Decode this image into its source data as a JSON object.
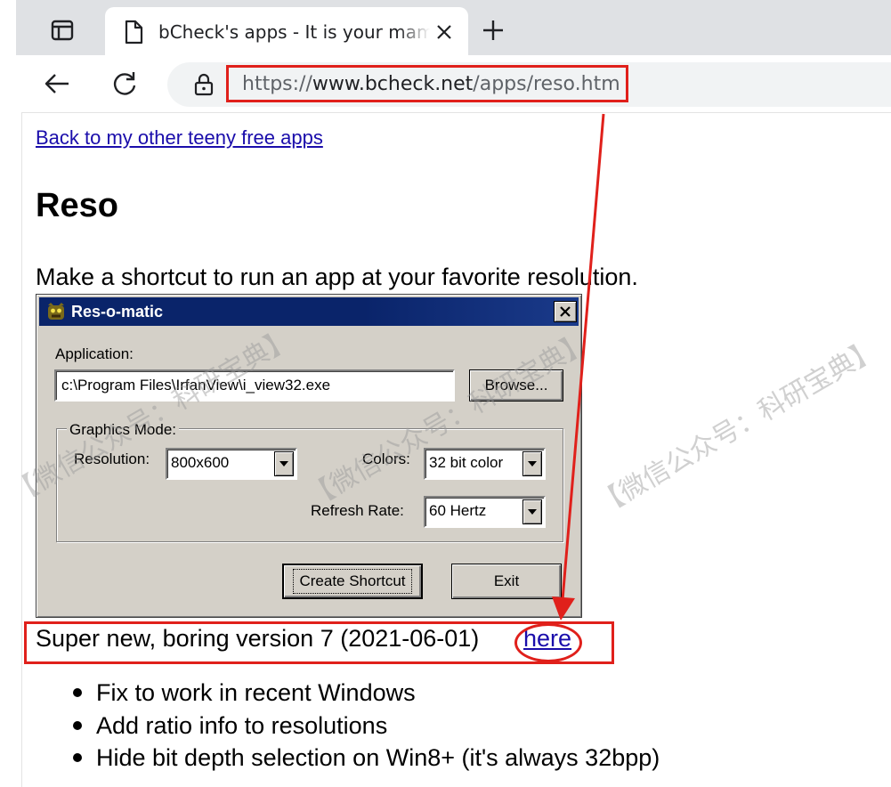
{
  "browser": {
    "tab_title": "bCheck's apps - It is your mama's",
    "url_prefix": "https://",
    "url_host": "www.bcheck.net",
    "url_path": "/apps/reso.htm"
  },
  "page": {
    "back_link": "Back to my other teeny free apps",
    "title": "Reso",
    "tagline": "Make a shortcut to run an app at your favorite resolution."
  },
  "dialog": {
    "title": "Res-o-matic",
    "application_label": "Application:",
    "application_value": "c:\\Program Files\\IrfanView\\i_view32.exe",
    "browse_button": "Browse...",
    "graphics_mode_label": "Graphics Mode:",
    "resolution_label": "Resolution:",
    "resolution_value": "800x600",
    "colors_label": "Colors:",
    "colors_value": "32 bit color",
    "refresh_label": "Refresh Rate:",
    "refresh_value": "60 Hertz",
    "create_button": "Create Shortcut",
    "exit_button": "Exit"
  },
  "version": {
    "text": "Super new, boring version 7 (2021-06-01)",
    "link": "here"
  },
  "notes": [
    "Fix to work in recent Windows",
    "Add ratio info to resolutions",
    "Hide bit depth selection on Win8+ (it's always 32bpp)"
  ],
  "watermark": "【微信公众号：科研宝典】",
  "colors": {
    "highlight": "#e0201b",
    "link": "#1a0dab",
    "dialog_title": "#0a246a",
    "dialog_face": "#d4d0c8"
  }
}
